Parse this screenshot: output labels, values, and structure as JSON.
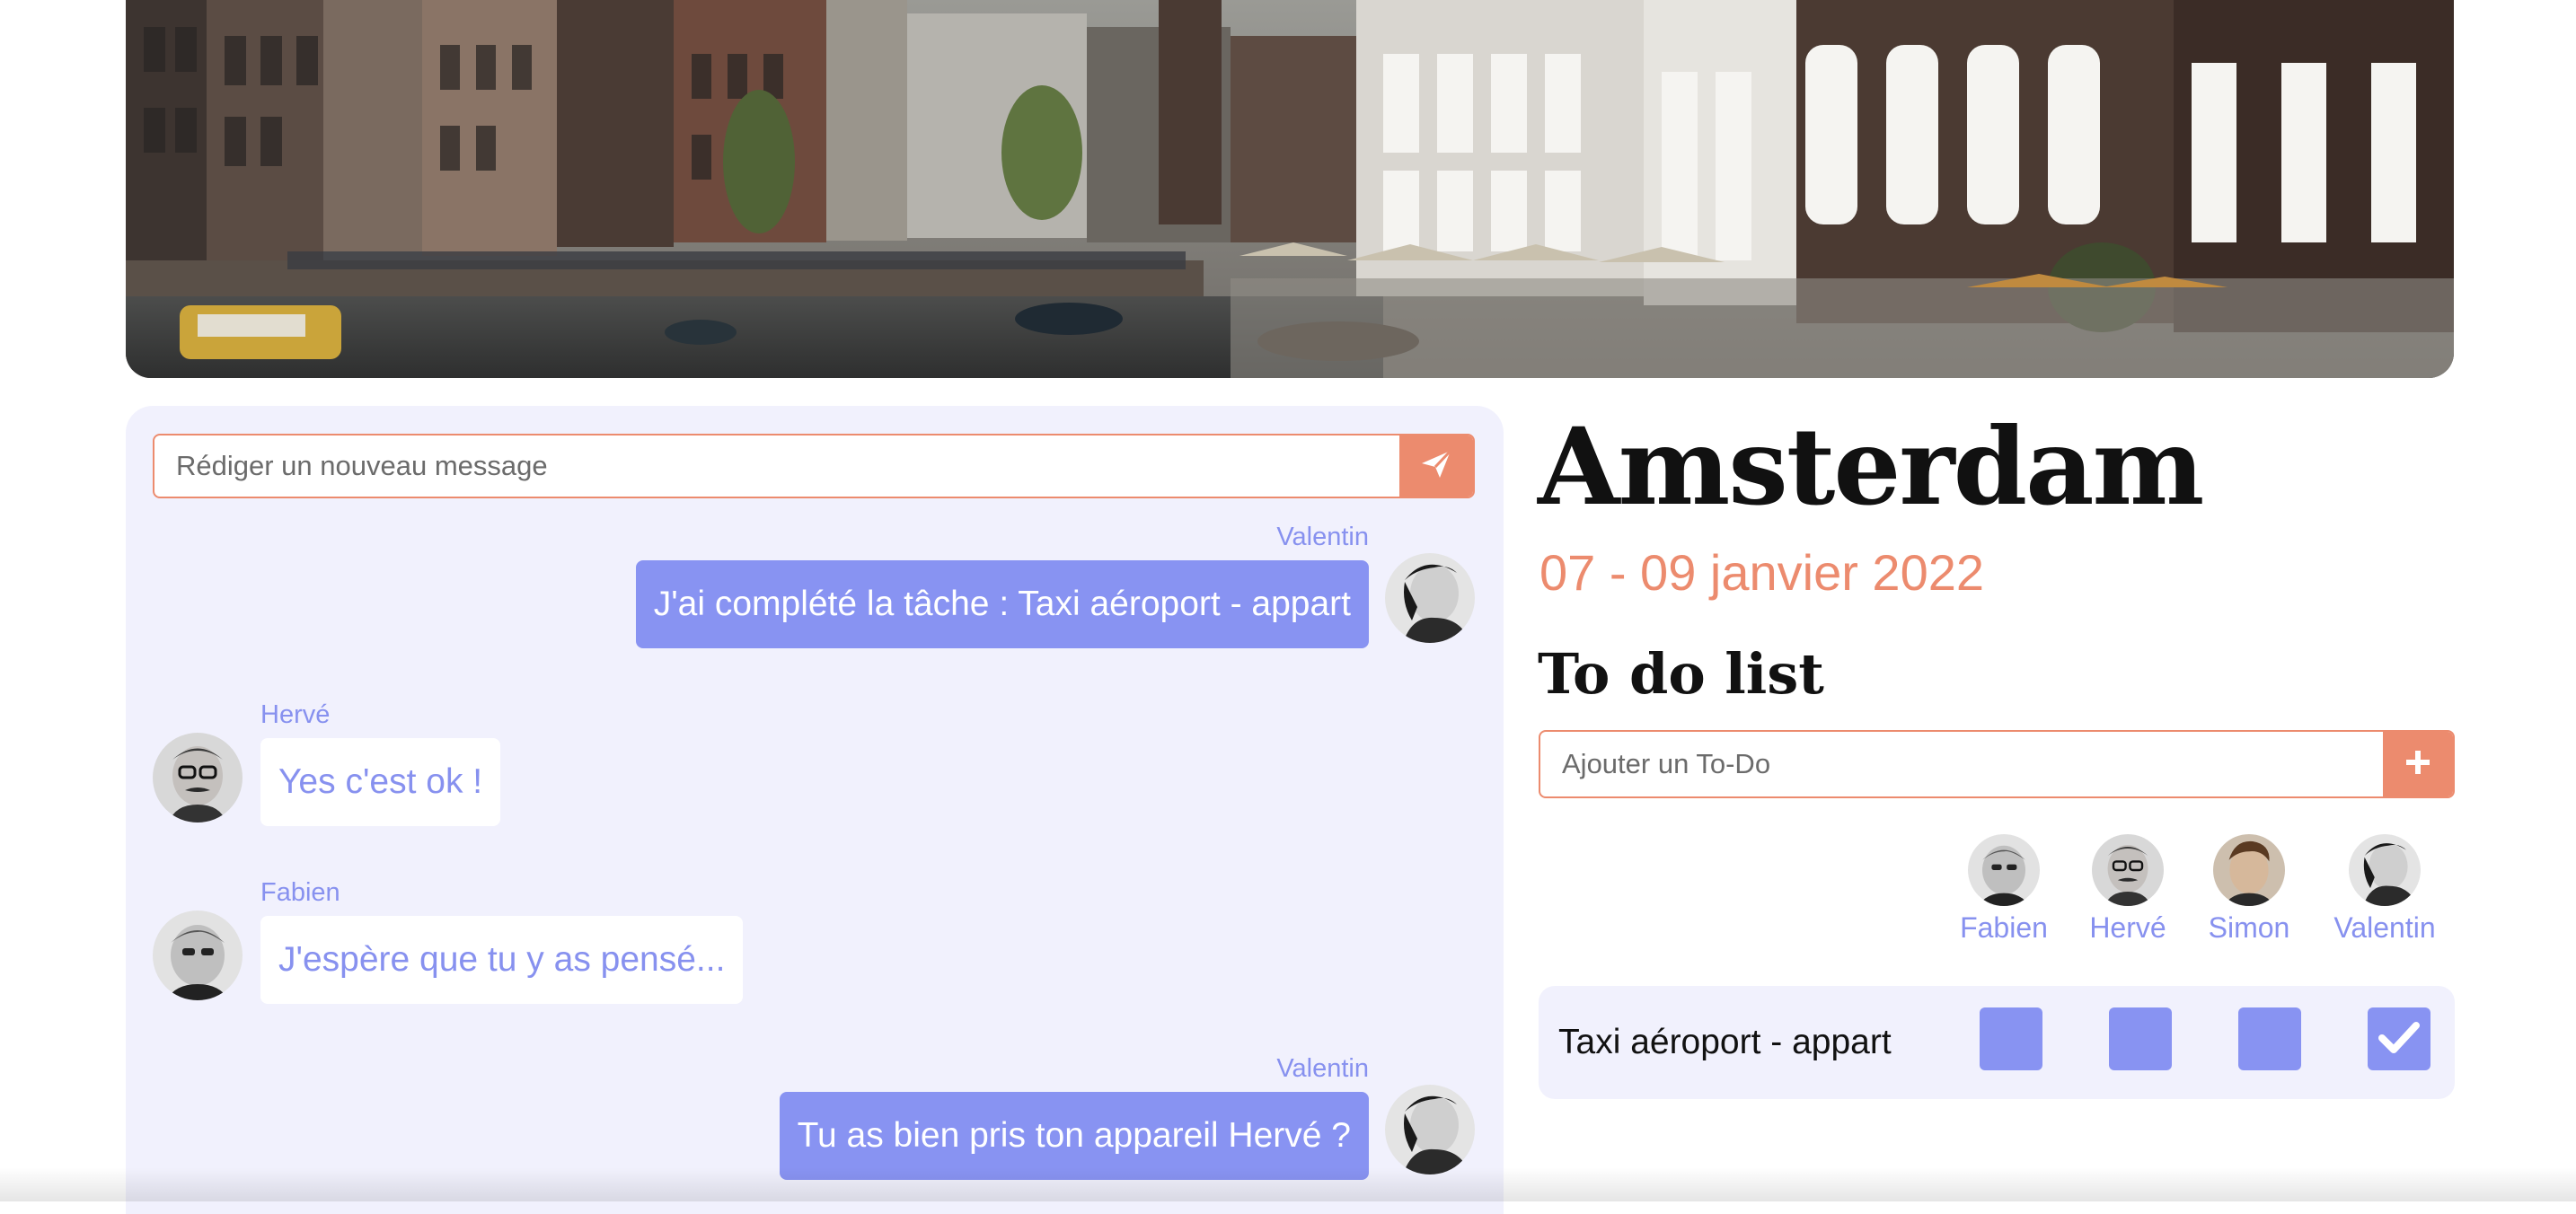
{
  "hero": {
    "alt": "Amsterdam canal"
  },
  "chat": {
    "input_placeholder": "Rédiger un nouveau message",
    "send_icon": "paper-plane-icon",
    "messages": [
      {
        "author": "Valentin",
        "text": "J'ai complété la tâche : Taxi aéroport - appart",
        "own": true
      },
      {
        "author": "Hervé",
        "text": "Yes c'est ok !",
        "own": false
      },
      {
        "author": "Fabien",
        "text": "J'espère que tu y as pensé...",
        "own": false
      },
      {
        "author": "Valentin",
        "text": "Tu as bien pris ton appareil Hervé ?",
        "own": true
      }
    ]
  },
  "trip": {
    "title": "Amsterdam",
    "dates": "07 - 09 janvier 2022"
  },
  "todo": {
    "title": "To do list",
    "input_placeholder": "Ajouter un To-Do",
    "add_icon": "plus-icon",
    "members": [
      "Fabien",
      "Hervé",
      "Simon",
      "Valentin"
    ],
    "tasks": [
      {
        "label": "Taxi aéroport - appart",
        "done": [
          false,
          false,
          false,
          true
        ]
      }
    ]
  },
  "colors": {
    "accent": "#ec8b6e",
    "primary": "#8893f2",
    "panel": "#f1f1fd"
  }
}
